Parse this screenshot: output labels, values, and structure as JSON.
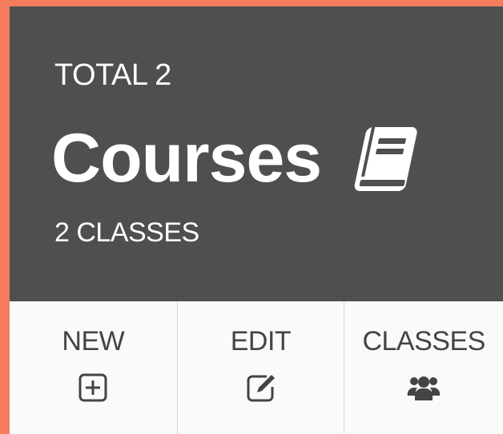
{
  "card": {
    "total_label": "TOTAL 2",
    "title": "Courses",
    "title_icon": "book-icon",
    "subtitle": "2 CLASSES"
  },
  "actions": [
    {
      "label": "NEW",
      "icon": "plus-square-icon"
    },
    {
      "label": "EDIT",
      "icon": "edit-icon"
    },
    {
      "label": "CLASSES",
      "icon": "users-icon"
    }
  ],
  "colors": {
    "background": "#f47e5b",
    "header": "#4f4f4f",
    "header_text": "#ffffff",
    "action_text": "#444444",
    "action_bg": "#fafafa"
  }
}
